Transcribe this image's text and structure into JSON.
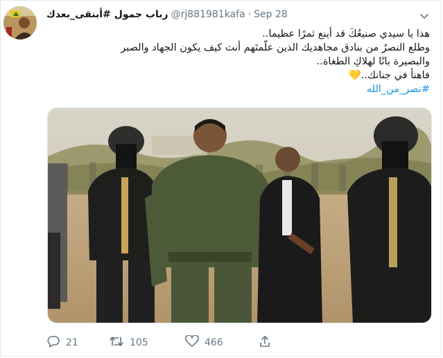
{
  "author": {
    "display_name": "رباب جمول #أبنقى_بعدك",
    "handle": "@rj881981kafa",
    "separator": "·",
    "date": "Sep 28"
  },
  "tweet": {
    "lines": [
      "هذا يا سيدي صنيعُكَ قد أينع ثمرًا عظيما..",
      "وطلع النصرُ من بنادق مجاهديك الذين علّمتَهم أنت كيف يكون الجهاد والصبر",
      "والبصيرة باتًا لهلاكِ الطغاة..",
      "فاهنأ في جنانك.."
    ],
    "emoji": "💛",
    "hashtag": "#نصر_من_الله"
  },
  "counts": {
    "replies": "21",
    "retweets": "105",
    "likes": "466"
  },
  "icons": {
    "reply": "reply-icon",
    "retweet": "retweet-icon",
    "like": "heart-icon",
    "share": "share-icon",
    "caret": "chevron-down-icon"
  },
  "colors": {
    "link": "#1b95e0",
    "meta": "#657786",
    "text": "#14171a",
    "emoji_heart": "#f4c430"
  }
}
